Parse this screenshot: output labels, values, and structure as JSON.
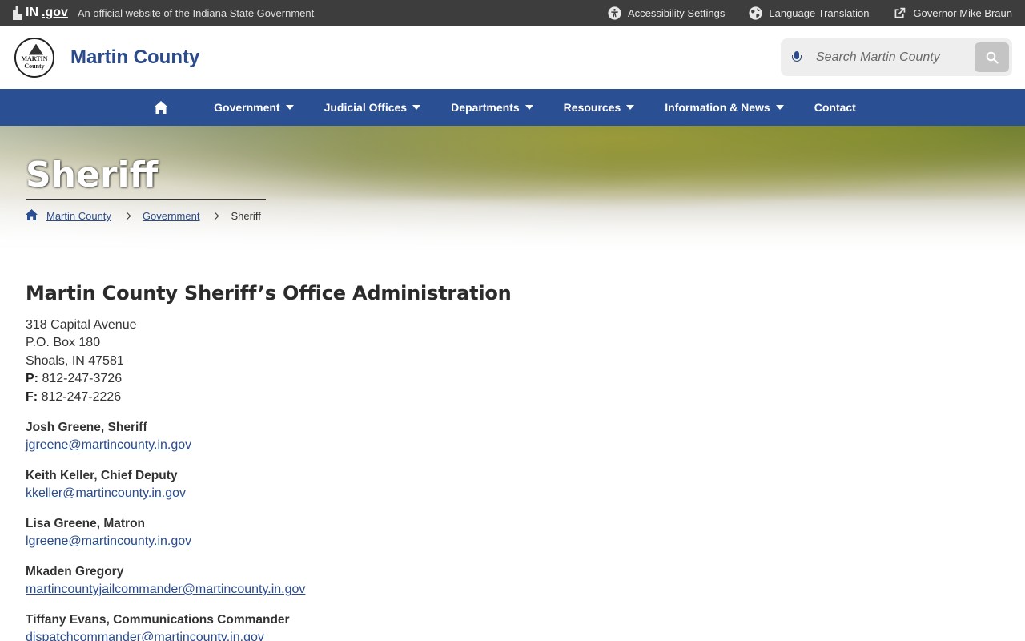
{
  "govbar": {
    "logo_text": "IN",
    "logo_suffix": ".gov",
    "official_text": "An official website of the Indiana State Government",
    "links": [
      {
        "label": "Accessibility Settings",
        "icon": "accessibility-icon"
      },
      {
        "label": "Language Translation",
        "icon": "globe-icon"
      },
      {
        "label": "Governor Mike Braun",
        "icon": "external-link-icon"
      }
    ]
  },
  "header": {
    "seal_text": "MARTIN County",
    "site_title": "Martin County",
    "search_placeholder": "Search Martin County"
  },
  "nav": {
    "items": [
      {
        "label": "Government",
        "has_dropdown": true
      },
      {
        "label": "Judicial Offices",
        "has_dropdown": true
      },
      {
        "label": "Departments",
        "has_dropdown": true
      },
      {
        "label": "Resources",
        "has_dropdown": true
      },
      {
        "label": "Information & News",
        "has_dropdown": true
      },
      {
        "label": "Contact",
        "has_dropdown": false
      }
    ]
  },
  "hero": {
    "title": "Sheriff",
    "breadcrumb": [
      "Martin County",
      "Government",
      "Sheriff"
    ]
  },
  "main": {
    "heading": "Martin County Sheriff’s Office Administration",
    "address": [
      "318 Capital Avenue",
      "P.O. Box 180",
      "Shoals, IN 47581"
    ],
    "phone_label": "P:",
    "phone": "812-247-3726",
    "fax_label": "F:",
    "fax": "812-247-2226",
    "staff": [
      {
        "name": "Josh Greene, Sheriff",
        "email": "jgreene@martincounty.in.gov"
      },
      {
        "name": "Keith Keller, Chief Deputy",
        "email": "kkeller@martincounty.in.gov"
      },
      {
        "name": "Lisa Greene, Matron",
        "email": "lgreene@martincounty.in.gov"
      },
      {
        "name": "Mkaden Gregory",
        "email": "martincountyjailcommander@martincounty.in.gov"
      },
      {
        "name": "Tiffany Evans, Communications Commander",
        "email": "dispatchcommander@martincounty.in.gov"
      }
    ]
  },
  "colors": {
    "brand_blue": "#2b4f93",
    "govbar_bg": "#3d3d3d",
    "link_blue": "#2b4b8b"
  }
}
